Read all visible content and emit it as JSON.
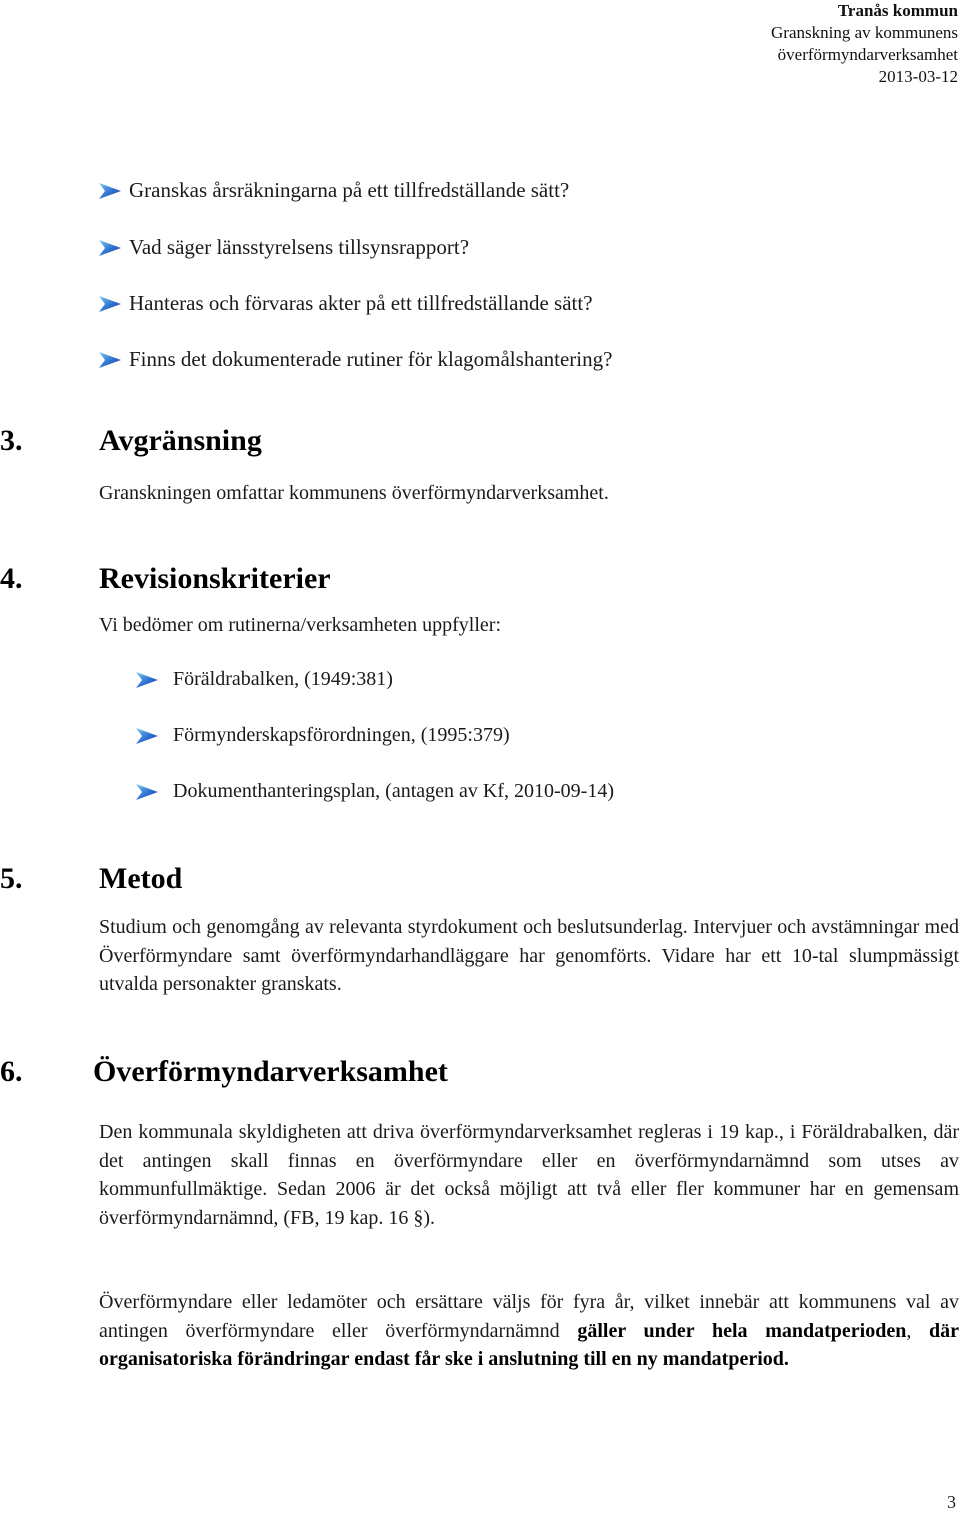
{
  "header": {
    "organization": "Tranås kommun",
    "report_title_line1": "Granskning av kommunens",
    "report_title_line2": "överförmyndarverksamhet",
    "date": "2013-03-12"
  },
  "questions": [
    "Granskas årsräkningarna på ett tillfredställande sätt?",
    "Vad säger länsstyrelsens tillsynsrapport?",
    "Hanteras och förvaras akter på ett tillfredställande sätt?",
    "Finns det dokumenterade rutiner för klagomålshantering?"
  ],
  "sections": {
    "s3": {
      "number": "3.",
      "title": "Avgränsning",
      "text": "Granskningen omfattar kommunens överförmyndarverksamhet."
    },
    "s4": {
      "number": "4.",
      "title": "Revisionskriterier",
      "intro": "Vi bedömer om rutinerna/verksamheten uppfyller:",
      "criteria": [
        "Föräldrabalken, (1949:381)",
        "Förmynderskapsförordningen, (1995:379)",
        "Dokumenthanteringsplan, (antagen av Kf, 2010-09-14)"
      ]
    },
    "s5": {
      "number": "5.",
      "title": "Metod",
      "text": "Studium och genomgång av relevanta styrdokument och beslutsunderlag. Intervjuer och avstämningar med Överförmyndare samt överförmyndarhandläggare har genomförts. Vidare har ett 10-tal slumpmässigt utvalda personakter granskats."
    },
    "s6": {
      "number": "6.",
      "title": "Överförmyndarverksamhet",
      "para1": "Den kommunala skyldigheten att driva överförmyndarverksamhet regleras i 19 kap., i Föräldrabalken, där det antingen skall finnas en överförmyndare eller en överförmyndarnämnd som utses av kommunfullmäktige. Sedan 2006 är det också möjligt att två eller fler kommuner har en gemensam överförmyndarnämnd, (FB, 19 kap. 16 §).",
      "para2_normal": "Överförmyndare eller ledamöter och ersättare väljs för fyra år, vilket innebär att kommunens val av antingen överförmyndare eller överförmyndarnämnd ",
      "para2_bold1": "gäller under hela mandatperioden",
      "para2_comma": ", ",
      "para2_bold2": "där organisatoriska förändringar endast får ske i anslutning till en ny mandatperiod."
    }
  },
  "footer": {
    "page_number": "3"
  },
  "icons": {
    "bullet": "arrowhead-bullet-icon"
  },
  "colors": {
    "bullet_dark": "#1d4fb3",
    "bullet_light": "#6fc1f0",
    "text": "#1a1a1a"
  }
}
